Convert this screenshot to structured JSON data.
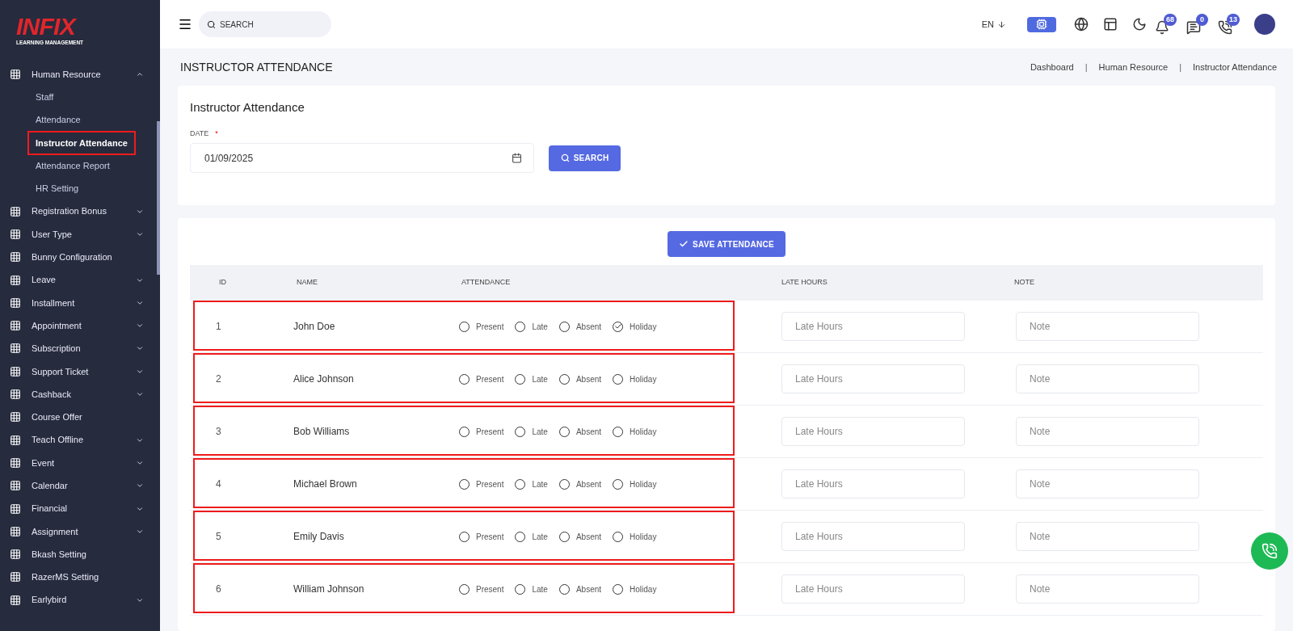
{
  "logo": {
    "name": "INFIX",
    "tagline": "LEARNING MANAGEMENT"
  },
  "sidebar": {
    "items": [
      {
        "label": "Human Resource",
        "expanded": true,
        "children": [
          {
            "label": "Staff",
            "highlighted": false
          },
          {
            "label": "Attendance",
            "highlighted": false
          },
          {
            "label": "Instructor Attendance",
            "highlighted": true
          },
          {
            "label": "Attendance Report",
            "highlighted": false
          },
          {
            "label": "HR Setting",
            "highlighted": false
          }
        ]
      },
      {
        "label": "Registration Bonus",
        "expanded": false
      },
      {
        "label": "User Type",
        "expanded": false
      },
      {
        "label": "Bunny Configuration"
      },
      {
        "label": "Leave",
        "expanded": false
      },
      {
        "label": "Installment",
        "expanded": false
      },
      {
        "label": "Appointment",
        "expanded": false
      },
      {
        "label": "Subscription",
        "expanded": false
      },
      {
        "label": "Support Ticket",
        "expanded": false
      },
      {
        "label": "Cashback",
        "expanded": false
      },
      {
        "label": "Course Offer"
      },
      {
        "label": "Teach Offline",
        "expanded": false
      },
      {
        "label": "Event",
        "expanded": false
      },
      {
        "label": "Calendar",
        "expanded": false
      },
      {
        "label": "Financial",
        "expanded": false
      },
      {
        "label": "Assignment",
        "expanded": false
      },
      {
        "label": "Bkash Setting"
      },
      {
        "label": "RazerMS Setting"
      },
      {
        "label": "Earlybird",
        "expanded": false
      }
    ]
  },
  "topbar": {
    "search": {
      "placeholder": "SEARCH"
    },
    "language": "EN",
    "notifications": "68",
    "messages": "0",
    "calls": "13"
  },
  "page_title": "INSTRUCTOR ATTENDANCE",
  "breadcrumb": [
    {
      "kind": "link",
      "text": "Dashboard"
    },
    {
      "kind": "separator",
      "text": "|"
    },
    {
      "kind": "link",
      "text": "Human Resource"
    },
    {
      "kind": "separator",
      "text": "|"
    },
    {
      "kind": "link",
      "text": "Instructor Attendance"
    }
  ],
  "filter": {
    "title": "Instructor Attendance",
    "date_label": "DATE",
    "required_mark": "*",
    "date_value": "01/09/2025",
    "search_button": "SEARCH"
  },
  "save_button": "SAVE ATTENDANCE",
  "table": {
    "columns": [
      "ID",
      "NAME",
      "ATTENDANCE",
      "LATE HOURS",
      "NOTE"
    ],
    "rows": [
      {
        "id": "1",
        "name": "John Doe",
        "highlighted": true,
        "options": [
          {
            "label": "Present",
            "selected": false
          },
          {
            "label": "Late",
            "selected": false
          },
          {
            "label": "Absent",
            "selected": false
          },
          {
            "label": "Holiday",
            "selected": true
          }
        ],
        "late_hours": {
          "placeholder": "Late Hours"
        },
        "note": {
          "placeholder": "Note"
        }
      },
      {
        "id": "2",
        "name": "Alice Johnson",
        "highlighted": true,
        "options": [
          {
            "label": "Present",
            "selected": false
          },
          {
            "label": "Late",
            "selected": false
          },
          {
            "label": "Absent",
            "selected": false
          },
          {
            "label": "Holiday",
            "selected": false
          }
        ],
        "late_hours": {
          "placeholder": "Late Hours"
        },
        "note": {
          "placeholder": "Note"
        }
      },
      {
        "id": "3",
        "name": "Bob Williams",
        "highlighted": true,
        "options": [
          {
            "label": "Present",
            "selected": false
          },
          {
            "label": "Late",
            "selected": false
          },
          {
            "label": "Absent",
            "selected": false
          },
          {
            "label": "Holiday",
            "selected": false
          }
        ],
        "late_hours": {
          "placeholder": "Late Hours"
        },
        "note": {
          "placeholder": "Note"
        }
      },
      {
        "id": "4",
        "name": "Michael Brown",
        "highlighted": true,
        "options": [
          {
            "label": "Present",
            "selected": false
          },
          {
            "label": "Late",
            "selected": false
          },
          {
            "label": "Absent",
            "selected": false
          },
          {
            "label": "Holiday",
            "selected": false
          }
        ],
        "late_hours": {
          "placeholder": "Late Hours"
        },
        "note": {
          "placeholder": "Note"
        }
      },
      {
        "id": "5",
        "name": "Emily Davis",
        "highlighted": true,
        "options": [
          {
            "label": "Present",
            "selected": false
          },
          {
            "label": "Late",
            "selected": false
          },
          {
            "label": "Absent",
            "selected": false
          },
          {
            "label": "Holiday",
            "selected": false
          }
        ],
        "late_hours": {
          "placeholder": "Late Hours"
        },
        "note": {
          "placeholder": "Note"
        }
      },
      {
        "id": "6",
        "name": "William Johnson",
        "highlighted": true,
        "options": [
          {
            "label": "Present",
            "selected": false
          },
          {
            "label": "Late",
            "selected": false
          },
          {
            "label": "Absent",
            "selected": false
          },
          {
            "label": "Holiday",
            "selected": false
          }
        ],
        "late_hours": {
          "placeholder": "Late Hours"
        },
        "note": {
          "placeholder": "Note"
        }
      }
    ]
  }
}
